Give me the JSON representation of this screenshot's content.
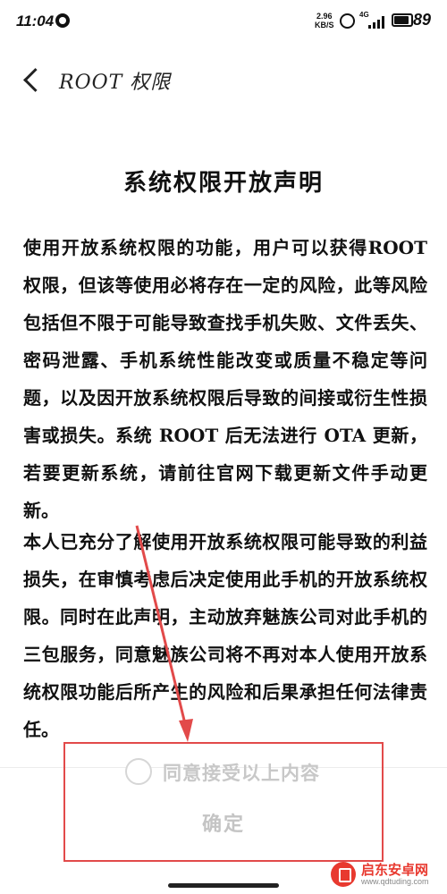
{
  "status_bar": {
    "time": "11:04",
    "net_speed_value": "2.96",
    "net_speed_unit": "KB/S",
    "network_type": "4G",
    "battery": "89"
  },
  "header": {
    "title": "ROOT 权限"
  },
  "document": {
    "title": "系统权限开放声明",
    "paragraph_1": "使用开放系统权限的功能，用户可以获得ROOT 权限，但该等使用必将存在一定的风险，此等风险包括但不限于可能导致查找手机失败、文件丢失、密码泄露、手机系统性能改变或质量不稳定等问题，以及因开放系统权限后导致的间接或衍生性损害或损失。系统 ROOT 后无法进行 OTA 更新，若要更新系统，请前往官网下载更新文件手动更新。",
    "paragraph_2": "本人已充分了解使用开放系统权限可能导致的利益损失，在审慎考虑后决定使用此手机的开放系统权限。同时在此声明，主动放弃魅族公司对此手机的三包服务，同意魅族公司将不再对本人使用开放系统权限功能后所产生的风险和后果承担任何法律责任。"
  },
  "footer": {
    "agree_label": "同意接受以上内容",
    "agree_checked": false,
    "confirm_label": "确定"
  },
  "annotation": {
    "color": "#e24a4a"
  },
  "watermark": {
    "name": "启东安卓网",
    "url": "www.qdtuding.com"
  }
}
